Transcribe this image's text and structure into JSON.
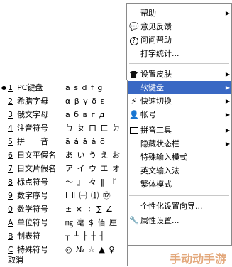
{
  "main_menu": {
    "items": [
      {
        "label": "帮助",
        "icon": "",
        "arrow": true
      },
      {
        "label": "意见反馈",
        "icon": "chat-icon"
      },
      {
        "label": "问问帮助",
        "icon": "question-icon"
      },
      {
        "label": "打字统计...",
        "icon": ""
      },
      {
        "label": "设置皮肤",
        "icon": "shirt-icon",
        "arrow": true
      },
      {
        "label": "软键盘",
        "icon": "",
        "arrow": true,
        "highlighted": true
      },
      {
        "label": "快速切换",
        "icon": "lightning-icon",
        "arrow": true
      },
      {
        "label": "帐号",
        "icon": "user-icon",
        "arrow": true
      },
      {
        "label": "拼音工具",
        "icon": "edit-icon",
        "arrow": true
      },
      {
        "label": "隐藏状态栏",
        "icon": "",
        "arrow": true
      },
      {
        "label": "特殊输入模式",
        "icon": ""
      },
      {
        "label": "英文输入法",
        "icon": ""
      },
      {
        "label": "繁体模式",
        "icon": ""
      },
      {
        "label": "个性化设置向导...",
        "icon": ""
      },
      {
        "label": "属性设置...",
        "icon": "wrench-icon"
      }
    ]
  },
  "soft_keyboard_menu": {
    "items": [
      {
        "num": "1",
        "name": "PC键盘",
        "preview": "a s d f g",
        "selected": true
      },
      {
        "num": "2",
        "name": "希腊字母",
        "preview": "α β γ δ ε"
      },
      {
        "num": "3",
        "name": "俄文字母",
        "preview": "а б в г д"
      },
      {
        "num": "4",
        "name": "注音符号",
        "preview": "ㄅ ㄆ ㄇ ㄈ ㄉ"
      },
      {
        "num": "5",
        "name": "拼　　音",
        "preview": "ā á ǎ à ō"
      },
      {
        "num": "6",
        "name": "日文平假名",
        "preview": "あ い う え お"
      },
      {
        "num": "7",
        "name": "日文片假名",
        "preview": "ア イ ウ エ オ"
      },
      {
        "num": "8",
        "name": "标点符号",
        "preview": "〜 』 々 ‖ 『"
      },
      {
        "num": "9",
        "name": "数字序号",
        "preview": "Ⅰ Ⅱ ㈠ ⑴ ⑫"
      },
      {
        "num": "0",
        "name": "数学符号",
        "preview": "± × ÷ ∑ ∠"
      },
      {
        "num": "A",
        "name": "单位符号",
        "preview": "㎎ 毫 $ 佰 厘"
      },
      {
        "num": "B",
        "name": "制表符",
        "preview": "┬ ┴ ├ ┼ ┤"
      },
      {
        "num": "C",
        "name": "特殊符号",
        "preview": "◎ № ☆ ▲ ♀"
      }
    ],
    "cancel_label": "取消"
  },
  "colors": {
    "highlight": "#3968c4",
    "border": "#8a8a8a"
  },
  "watermark": "手动动手游"
}
